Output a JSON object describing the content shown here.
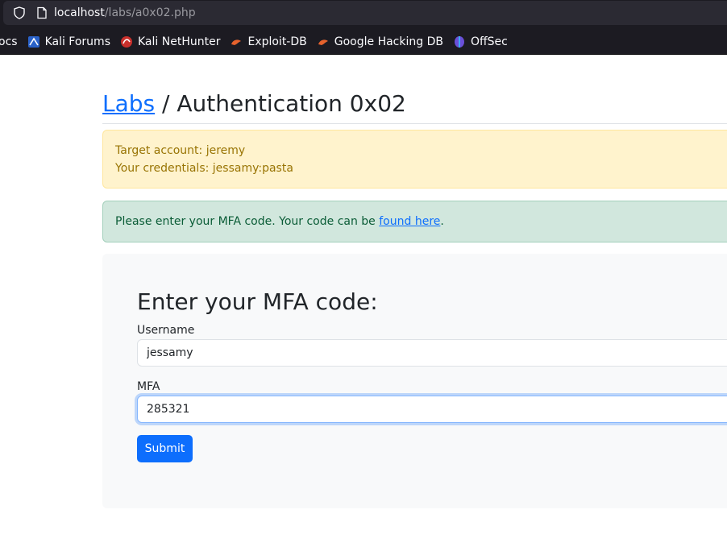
{
  "browser": {
    "url_host": "localhost",
    "url_path": "/labs/a0x02.php",
    "bookmarks": [
      {
        "label": "ocs",
        "icon": "none"
      },
      {
        "label": "Kali Forums",
        "icon": "kali-dragon-icon"
      },
      {
        "label": "Kali NetHunter",
        "icon": "nethunter-icon"
      },
      {
        "label": "Exploit-DB",
        "icon": "exploit-db-icon"
      },
      {
        "label": "Google Hacking DB",
        "icon": "ghdb-icon"
      },
      {
        "label": "OffSec",
        "icon": "offsec-icon"
      }
    ]
  },
  "page": {
    "breadcrumb_link": "Labs",
    "breadcrumb_rest": " / Authentication 0x02",
    "alert_warning": {
      "line1": "Target account: jeremy",
      "line2": "Your credentials: jessamy:pasta"
    },
    "alert_success": {
      "text": "Please enter your MFA code. Your code can be ",
      "link": "found here",
      "suffix": "."
    },
    "form": {
      "heading": "Enter your MFA code:",
      "username_label": "Username",
      "username_value": "jessamy",
      "mfa_label": "MFA",
      "mfa_value": "285321",
      "submit_label": "Submit"
    }
  },
  "colors": {
    "link": "#0d6efd",
    "warning_bg": "#fff3cd",
    "success_bg": "#d1e7dd",
    "button": "#0d6efd"
  }
}
